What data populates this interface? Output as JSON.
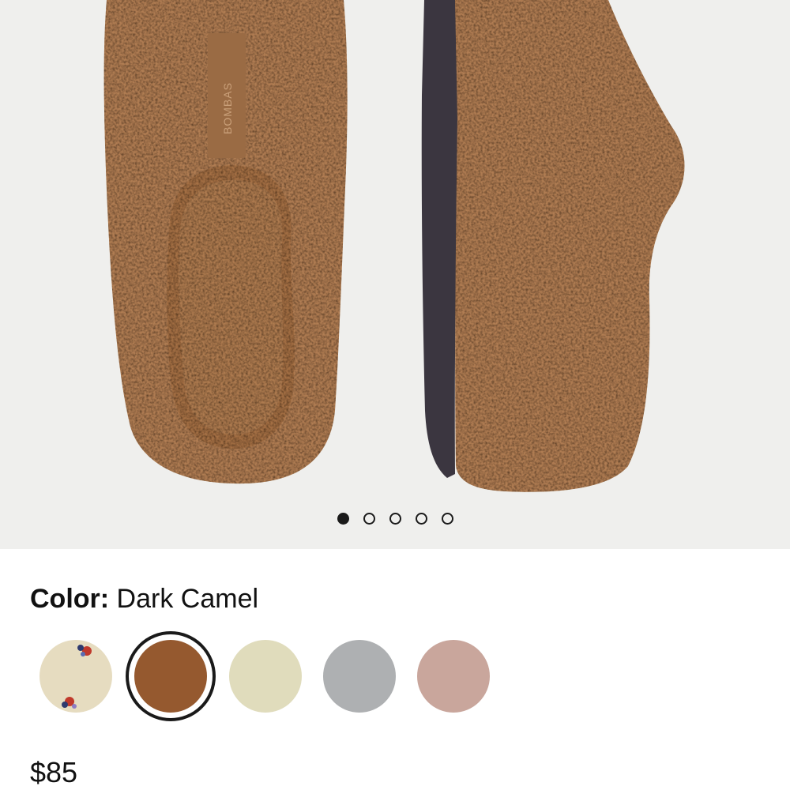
{
  "product": {
    "brand_tag": "BOMBAS",
    "color_label": "Color:",
    "color_value": "Dark Camel",
    "price": "$85"
  },
  "gallery": {
    "slide_count": 5,
    "active_slide": 1
  },
  "swatches": [
    {
      "name": "floral-print",
      "color": "#e6dcc0"
    },
    {
      "name": "dark-camel",
      "color": "#95592f",
      "selected": true
    },
    {
      "name": "cream",
      "color": "#e0dcbc"
    },
    {
      "name": "gray",
      "color": "#aeb0b2"
    },
    {
      "name": "blush",
      "color": "#c9a69c"
    }
  ],
  "colors": {
    "slipper": "#b07d52",
    "sole": "#3b3640",
    "background": "#efefed"
  }
}
